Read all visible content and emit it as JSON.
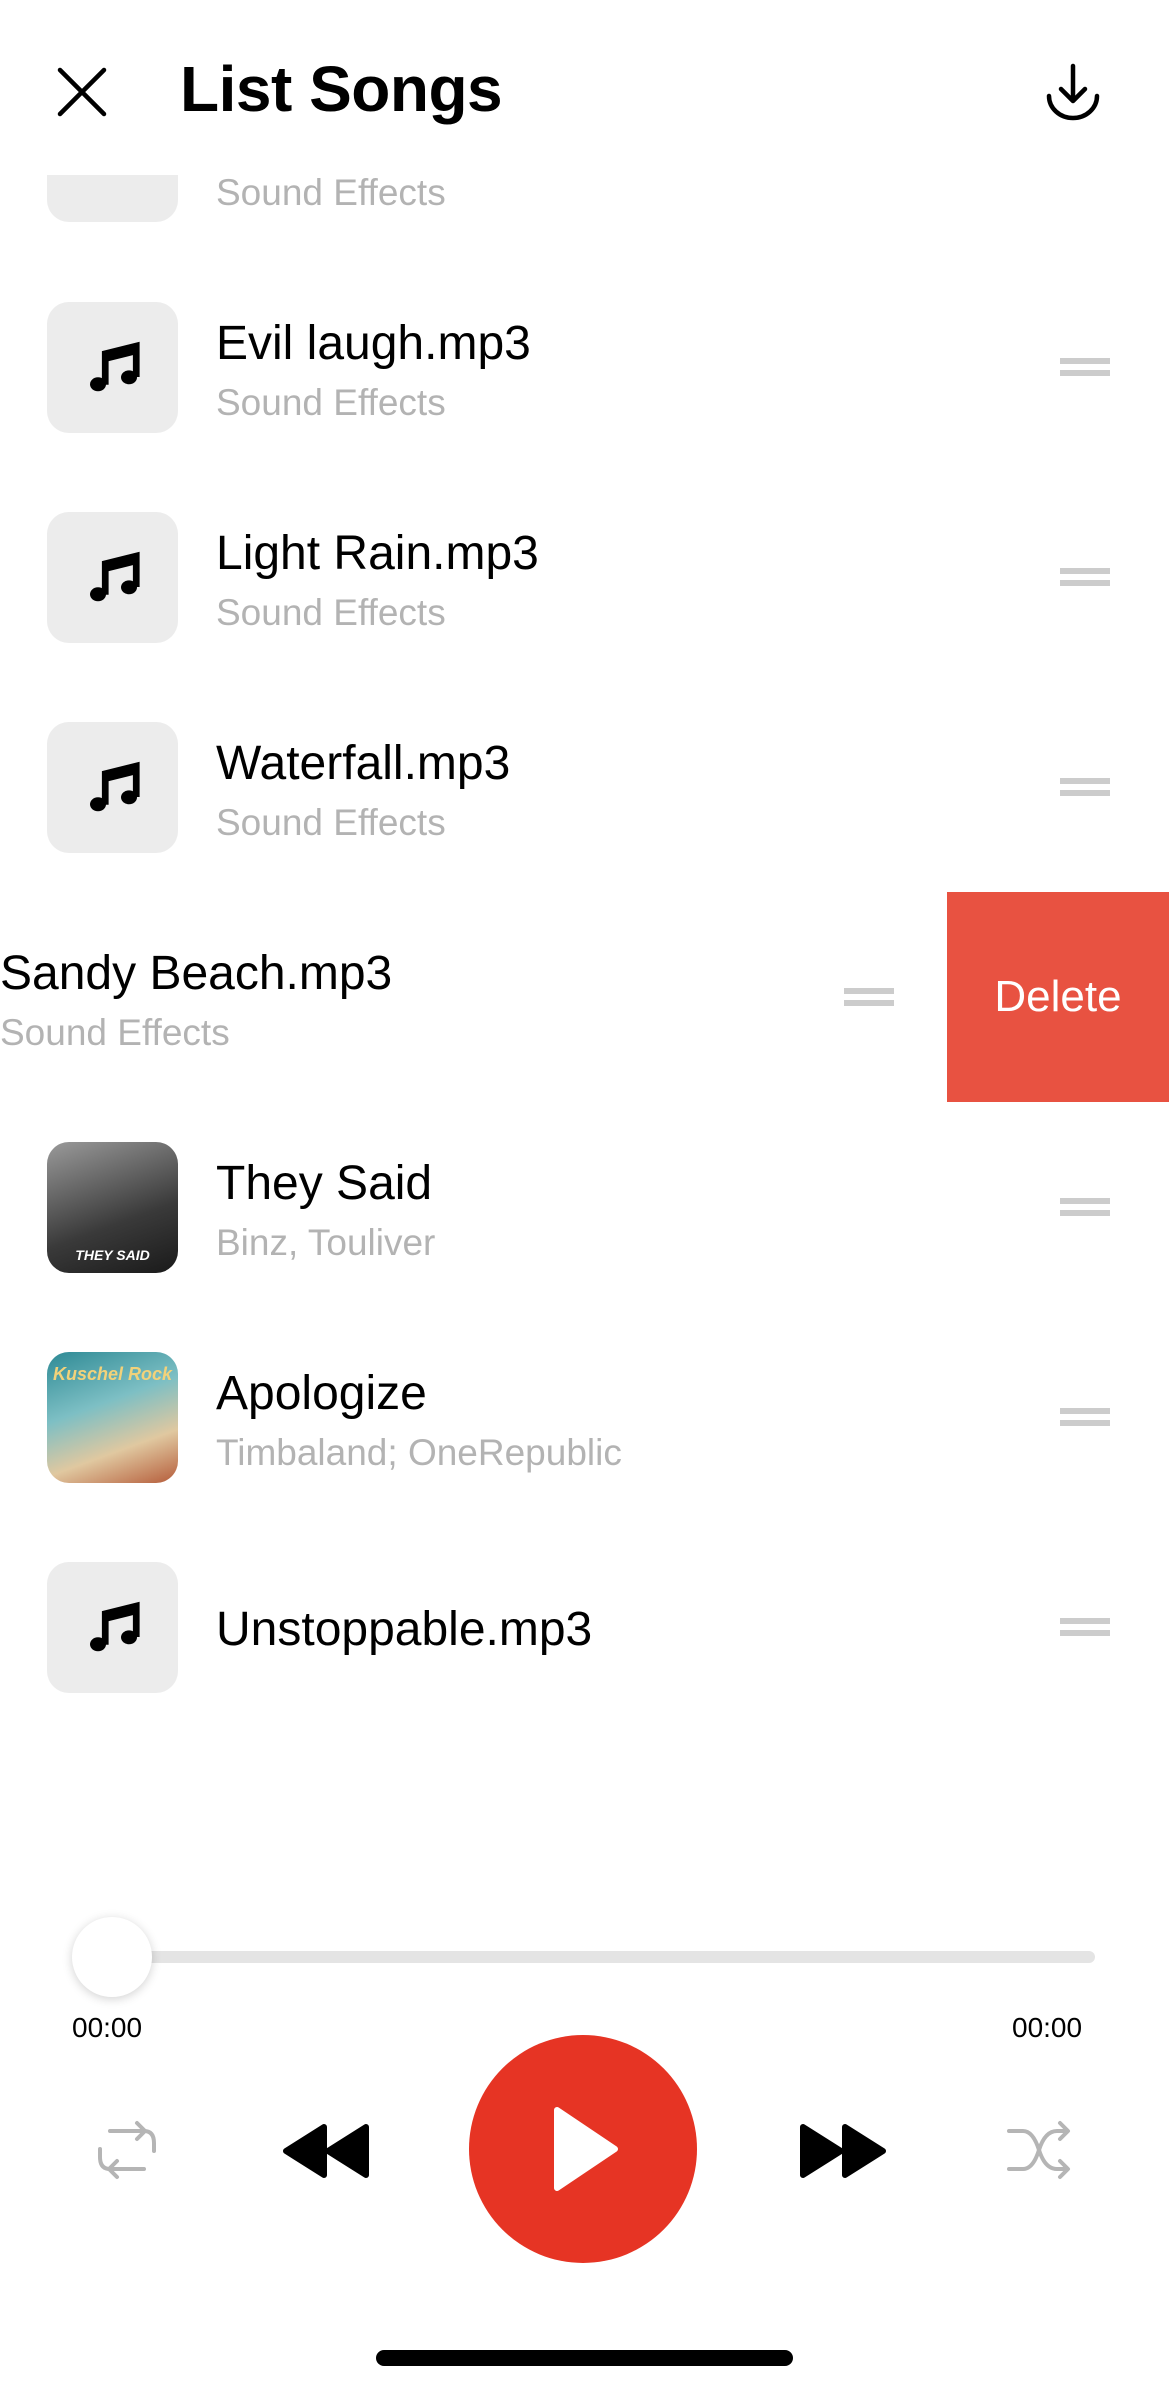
{
  "header": {
    "title": "List Songs",
    "close_icon": "close-icon",
    "download_icon": "download-icon"
  },
  "songs": [
    {
      "title": "",
      "subtitle": "Sound Effects",
      "art": "music-note-icon",
      "partial": true
    },
    {
      "title": "Evil laugh.mp3",
      "subtitle": "Sound Effects",
      "art": "music-note-icon"
    },
    {
      "title": "Light Rain.mp3",
      "subtitle": "Sound Effects",
      "art": "music-note-icon"
    },
    {
      "title": "Waterfall.mp3",
      "subtitle": "Sound Effects",
      "art": "music-note-icon"
    },
    {
      "title": "Sandy Beach.mp3",
      "subtitle": "Sound Effects",
      "art": "music-note-icon",
      "swiped": true
    },
    {
      "title": "They Said",
      "subtitle": "Binz,  Touliver",
      "art": "album-art",
      "art_text": "THEY SAID"
    },
    {
      "title": "Apologize",
      "subtitle": "Timbaland; OneRepublic",
      "art": "album-art",
      "art_text": "Kuschel Rock"
    },
    {
      "title": "Unstoppable.mp3",
      "subtitle": "",
      "art": "music-note-icon"
    }
  ],
  "swipe_action": {
    "label": "Delete",
    "color": "#e85241"
  },
  "player": {
    "elapsed": "00:00",
    "duration": "00:00",
    "progress": 0,
    "accent_color": "#e63424",
    "controls": [
      "repeat-icon",
      "previous-icon",
      "play-icon",
      "next-icon",
      "shuffle-icon"
    ]
  }
}
